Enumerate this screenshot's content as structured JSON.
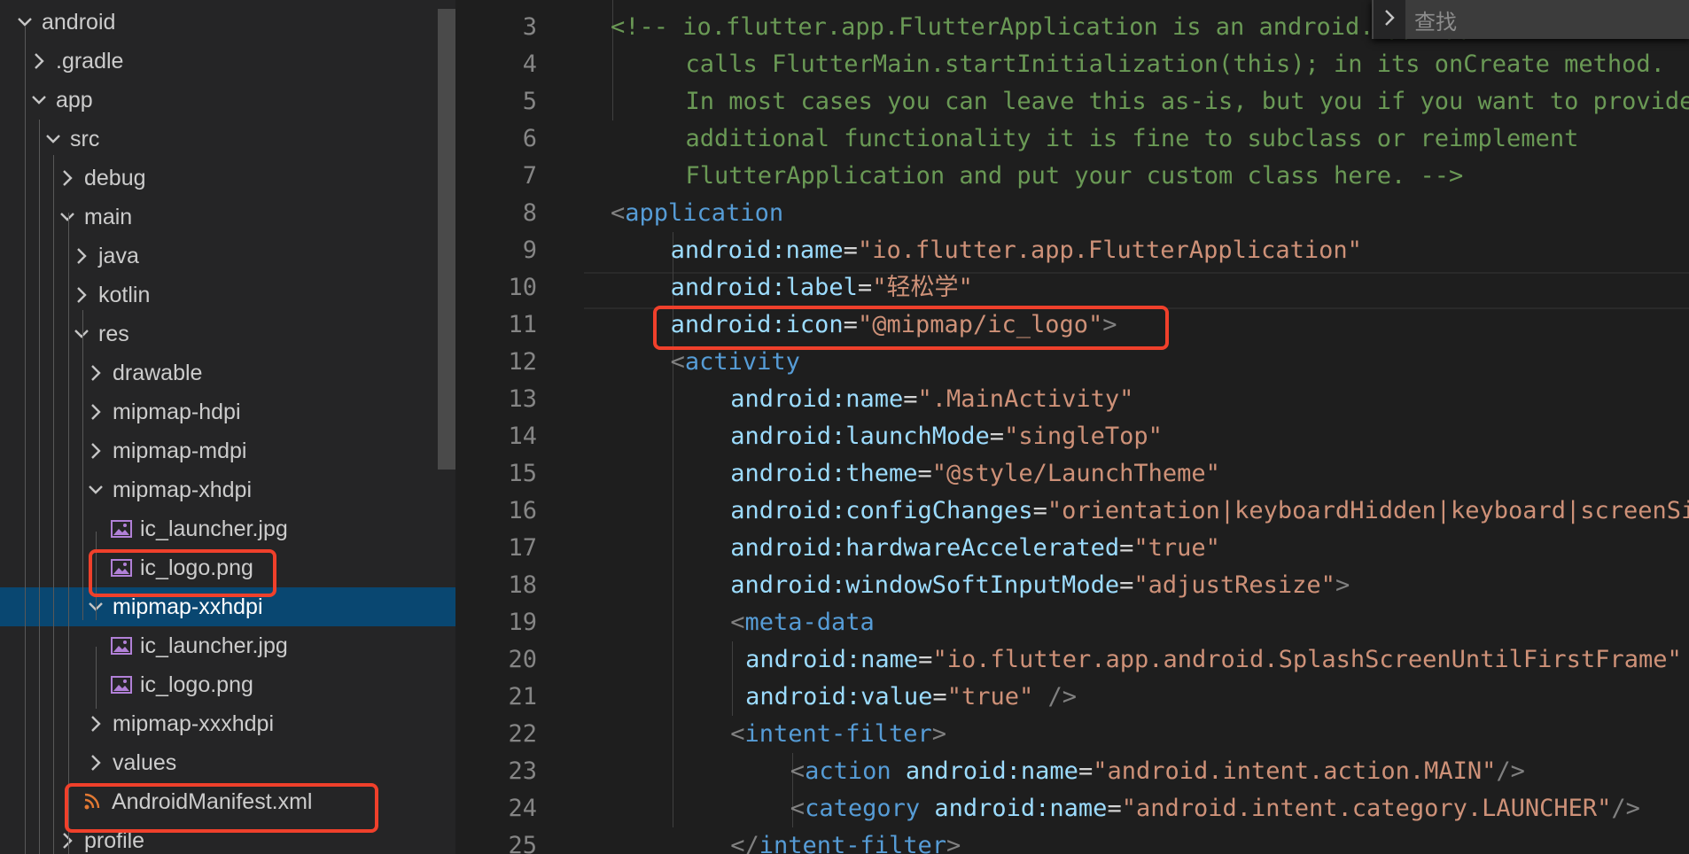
{
  "explorer": {
    "items": [
      {
        "label": "android",
        "depth": 0,
        "type": "folder",
        "expanded": true
      },
      {
        "label": ".gradle",
        "depth": 1,
        "type": "folder",
        "expanded": false
      },
      {
        "label": "app",
        "depth": 1,
        "type": "folder",
        "expanded": true
      },
      {
        "label": "src",
        "depth": 2,
        "type": "folder",
        "expanded": true
      },
      {
        "label": "debug",
        "depth": 3,
        "type": "folder",
        "expanded": false
      },
      {
        "label": "main",
        "depth": 3,
        "type": "folder",
        "expanded": true
      },
      {
        "label": "java",
        "depth": 4,
        "type": "folder",
        "expanded": false
      },
      {
        "label": "kotlin",
        "depth": 4,
        "type": "folder",
        "expanded": false
      },
      {
        "label": "res",
        "depth": 4,
        "type": "folder",
        "expanded": true
      },
      {
        "label": "drawable",
        "depth": 5,
        "type": "folder",
        "expanded": false
      },
      {
        "label": "mipmap-hdpi",
        "depth": 5,
        "type": "folder",
        "expanded": false
      },
      {
        "label": "mipmap-mdpi",
        "depth": 5,
        "type": "folder",
        "expanded": false
      },
      {
        "label": "mipmap-xhdpi",
        "depth": 5,
        "type": "folder",
        "expanded": true
      },
      {
        "label": "ic_launcher.jpg",
        "depth": 6,
        "type": "image"
      },
      {
        "label": "ic_logo.png",
        "depth": 6,
        "type": "image",
        "highlighted": true
      },
      {
        "label": "mipmap-xxhdpi",
        "depth": 5,
        "type": "folder",
        "expanded": true,
        "selected": true
      },
      {
        "label": "ic_launcher.jpg",
        "depth": 6,
        "type": "image"
      },
      {
        "label": "ic_logo.png",
        "depth": 6,
        "type": "image"
      },
      {
        "label": "mipmap-xxxhdpi",
        "depth": 5,
        "type": "folder",
        "expanded": false
      },
      {
        "label": "values",
        "depth": 5,
        "type": "folder",
        "expanded": false
      },
      {
        "label": "AndroidManifest.xml",
        "depth": 4,
        "type": "xml",
        "highlighted": true
      },
      {
        "label": "profile",
        "depth": 3,
        "type": "folder",
        "expanded": false
      }
    ]
  },
  "find_widget": {
    "placeholder": "查找",
    "toggle_icon": "chevron-right-icon"
  },
  "editor": {
    "lines": [
      {
        "n": "3",
        "indent": 0,
        "tokens": [
          [
            "com",
            "<!-- io.flutter.app.FlutterApplication is an android.app.Application that"
          ]
        ]
      },
      {
        "n": "4",
        "indent": 5,
        "tokens": [
          [
            "com",
            "calls FlutterMain.startInitialization(this); in its onCreate method."
          ]
        ]
      },
      {
        "n": "5",
        "indent": 5,
        "tokens": [
          [
            "com",
            "In most cases you can leave this as-is, but you if you want to provide"
          ]
        ]
      },
      {
        "n": "6",
        "indent": 5,
        "tokens": [
          [
            "com",
            "additional functionality it is fine to subclass or reimplement"
          ]
        ]
      },
      {
        "n": "7",
        "indent": 5,
        "tokens": [
          [
            "com",
            "FlutterApplication and put your custom class here. -->"
          ]
        ]
      },
      {
        "n": "8",
        "indent": 0,
        "tokens": [
          [
            "pun",
            "<"
          ],
          [
            "tag",
            "application"
          ]
        ]
      },
      {
        "n": "9",
        "indent": 4,
        "tokens": [
          [
            "attr",
            "android:name"
          ],
          [
            "eq",
            "="
          ],
          [
            "str",
            "\"io.flutter.app.FlutterApplication\""
          ]
        ]
      },
      {
        "n": "10",
        "indent": 4,
        "tokens": [
          [
            "attr",
            "android:label"
          ],
          [
            "eq",
            "="
          ],
          [
            "str",
            "\"轻松学\""
          ]
        ]
      },
      {
        "n": "11",
        "indent": 4,
        "tokens": [
          [
            "attr",
            "android:icon"
          ],
          [
            "eq",
            "="
          ],
          [
            "str",
            "\"@mipmap/ic_logo\""
          ],
          [
            "pun",
            ">"
          ]
        ]
      },
      {
        "n": "12",
        "indent": 4,
        "tokens": [
          [
            "pun",
            "<"
          ],
          [
            "tag",
            "activity"
          ]
        ]
      },
      {
        "n": "13",
        "indent": 8,
        "tokens": [
          [
            "attr",
            "android:name"
          ],
          [
            "eq",
            "="
          ],
          [
            "str",
            "\".MainActivity\""
          ]
        ]
      },
      {
        "n": "14",
        "indent": 8,
        "tokens": [
          [
            "attr",
            "android:launchMode"
          ],
          [
            "eq",
            "="
          ],
          [
            "str",
            "\"singleTop\""
          ]
        ]
      },
      {
        "n": "15",
        "indent": 8,
        "tokens": [
          [
            "attr",
            "android:theme"
          ],
          [
            "eq",
            "="
          ],
          [
            "str",
            "\"@style/LaunchTheme\""
          ]
        ]
      },
      {
        "n": "16",
        "indent": 8,
        "tokens": [
          [
            "attr",
            "android:configChanges"
          ],
          [
            "eq",
            "="
          ],
          [
            "str",
            "\"orientation|keyboardHidden|keyboard|screenSize"
          ]
        ]
      },
      {
        "n": "17",
        "indent": 8,
        "tokens": [
          [
            "attr",
            "android:hardwareAccelerated"
          ],
          [
            "eq",
            "="
          ],
          [
            "str",
            "\"true\""
          ]
        ]
      },
      {
        "n": "18",
        "indent": 8,
        "tokens": [
          [
            "attr",
            "android:windowSoftInputMode"
          ],
          [
            "eq",
            "="
          ],
          [
            "str",
            "\"adjustResize\""
          ],
          [
            "pun",
            ">"
          ]
        ]
      },
      {
        "n": "19",
        "indent": 8,
        "tokens": [
          [
            "pun",
            "<"
          ],
          [
            "tag",
            "meta-data"
          ]
        ]
      },
      {
        "n": "20",
        "indent": 9,
        "tokens": [
          [
            "attr",
            "android:name"
          ],
          [
            "eq",
            "="
          ],
          [
            "str",
            "\"io.flutter.app.android.SplashScreenUntilFirstFrame\""
          ]
        ]
      },
      {
        "n": "21",
        "indent": 9,
        "tokens": [
          [
            "attr",
            "android:value"
          ],
          [
            "eq",
            "="
          ],
          [
            "str",
            "\"true\""
          ],
          [
            "pun",
            " />"
          ]
        ]
      },
      {
        "n": "22",
        "indent": 8,
        "tokens": [
          [
            "pun",
            "<"
          ],
          [
            "tag",
            "intent-filter"
          ],
          [
            "pun",
            ">"
          ]
        ]
      },
      {
        "n": "23",
        "indent": 12,
        "tokens": [
          [
            "pun",
            "<"
          ],
          [
            "tag",
            "action"
          ],
          [
            "pun",
            " "
          ],
          [
            "attr",
            "android:name"
          ],
          [
            "eq",
            "="
          ],
          [
            "str",
            "\"android.intent.action.MAIN\""
          ],
          [
            "pun",
            "/>"
          ]
        ]
      },
      {
        "n": "24",
        "indent": 12,
        "tokens": [
          [
            "pun",
            "<"
          ],
          [
            "tag",
            "category"
          ],
          [
            "pun",
            " "
          ],
          [
            "attr",
            "android:name"
          ],
          [
            "eq",
            "="
          ],
          [
            "str",
            "\"android.intent.category.LAUNCHER\""
          ],
          [
            "pun",
            "/>"
          ]
        ]
      },
      {
        "n": "25",
        "indent": 8,
        "tokens": [
          [
            "pun",
            "</"
          ],
          [
            "tag",
            "intent-filter"
          ],
          [
            "pun",
            ">"
          ]
        ]
      }
    ]
  },
  "colors": {
    "highlight_box": "#f0402b",
    "selection": "#094771",
    "comment": "#6a9955",
    "tag": "#569cd6",
    "attr": "#9cdcfe",
    "string": "#ce9178"
  }
}
